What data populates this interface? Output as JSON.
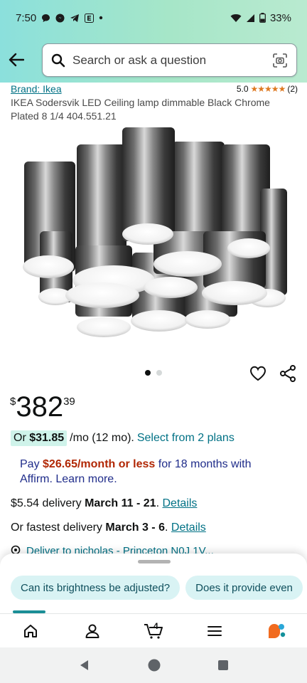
{
  "status": {
    "time": "7:50",
    "battery": "33%"
  },
  "search": {
    "placeholder": "Search or ask a question"
  },
  "product": {
    "brand": "Brand: Ikea",
    "rating_value": "5.0",
    "rating_stars": "★★★★★",
    "rating_count": "(2)",
    "title": "IKEA Sodersvik LED Ceiling lamp dimmable Black Chrome Plated 8 1/4 404.551.21",
    "image_alt": "chrome cylinder ceiling lamp"
  },
  "price": {
    "symbol": "$",
    "whole": "382",
    "fraction": "39"
  },
  "monthly": {
    "prefix": "Or",
    "amount": "$31.85",
    "terms": "/mo (12 mo).",
    "link": "Select from 2 plans"
  },
  "affirm": {
    "prefix": "Pay",
    "amount": "$26.65/month or less",
    "suffix": "for 18 months with",
    "line2": "Affirm. Learn more."
  },
  "delivery1": {
    "prefix": "$5.54 delivery",
    "date": "March 11 - 21",
    "sep": ".",
    "link": "Details"
  },
  "delivery2": {
    "prefix": "Or fastest delivery",
    "date": "March 3 - 6",
    "sep": ".",
    "link": "Details"
  },
  "deliver_to": "Deliver to nicholas - Princeton N0J 1V...",
  "chips": [
    "Can its brightness be adjusted?",
    "Does it provide even"
  ],
  "tabs": {
    "cart_count": "4"
  },
  "icons": {
    "back": "arrow-left-icon",
    "search": "search-icon",
    "camera": "camera-scan-icon",
    "heart": "heart-icon",
    "share": "share-icon",
    "home": "home-icon",
    "account": "account-icon",
    "cart": "cart-icon",
    "menu": "menu-icon",
    "rufus": "rufus-icon"
  },
  "colors": {
    "link": "#007185",
    "price_highlight": "#cff3ea",
    "affirm_text": "#1f2c8a",
    "affirm_amount": "#b12704",
    "stars": "#de7921",
    "header_gradient_start": "#8be0dc"
  }
}
